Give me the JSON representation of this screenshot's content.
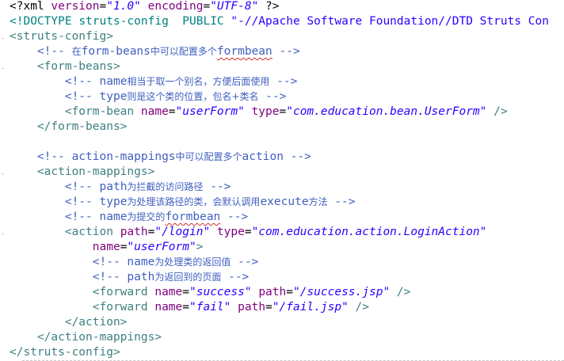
{
  "editor": {
    "lines": [
      [
        "<?xml version=\"1.0\" encoding=\"UTF-8\" ?>"
      ],
      [
        "<!DOCTYPE struts-config  PUBLIC \"-//Apache Software Foundation//DTD Struts Con"
      ],
      [
        "<struts-config>"
      ],
      [
        "    <!-- 在form-beans中可以配置多个formbean -->"
      ],
      [
        "    <form-beans>"
      ],
      [
        "        <!-- name相当于取一个别名，方便后面使用 -->"
      ],
      [
        "        <!-- type则是这个类的位置，包名+类名 -->"
      ],
      [
        "        <form-bean name=\"userForm\" type=\"com.education.bean.UserForm\" />"
      ],
      [
        "    </form-beans>"
      ],
      [
        ""
      ],
      [
        "    <!-- action-mappings中可以配置多个action -->"
      ],
      [
        "    <action-mappings>"
      ],
      [
        "        <!-- path为拦截的访问路径 -->"
      ],
      [
        "        <!-- type为处理该路径的类，会默认调用execute方法 -->"
      ],
      [
        "        <!-- name为提交的formbean -->"
      ],
      [
        "        <action path=\"/login\" type=\"com.education.action.LoginAction\""
      ],
      [
        "            name=\"userForm\">"
      ],
      [
        "            <!-- name为处理类的返回值 -->"
      ],
      [
        "            <!-- path为返回到的页面 -->"
      ],
      [
        "            <forward name=\"success\" path=\"/success.jsp\" />"
      ],
      [
        "            <forward name=\"fail\" path=\"/fail.jsp\" />"
      ],
      [
        "        </action>"
      ],
      [
        "    </action-mappings>"
      ],
      [
        "</struts-config>"
      ]
    ],
    "tokens": {
      "l0": [
        {
          "t": "<?xml ",
          "c": "pi"
        },
        {
          "t": "version",
          "c": "attr"
        },
        {
          "t": "=",
          "c": "pi"
        },
        {
          "t": "\"1.0\"",
          "c": "val"
        },
        {
          "t": " ",
          "c": "pi"
        },
        {
          "t": "encoding",
          "c": "attr"
        },
        {
          "t": "=",
          "c": "pi"
        },
        {
          "t": "\"UTF-8\"",
          "c": "val"
        },
        {
          "t": " ?>",
          "c": "pi"
        }
      ],
      "l1": [
        {
          "t": "<!DOCTYPE ",
          "c": "decl"
        },
        {
          "t": "struts-config",
          "c": "decl"
        },
        {
          "t": "  PUBLIC ",
          "c": "decl"
        },
        {
          "t": "\"-//Apache Software Foundation//DTD Struts Con",
          "c": "doctxt"
        }
      ],
      "l2": [
        {
          "t": "<struts-config>",
          "c": "tag"
        }
      ],
      "l3": [
        {
          "t": "    ",
          "c": ""
        },
        {
          "t": "<!-- ",
          "c": "cm"
        },
        {
          "t": "在",
          "c": "cm cjk"
        },
        {
          "t": "form-beans",
          "c": "cm"
        },
        {
          "t": "中可以配置多个",
          "c": "cm cjk"
        },
        {
          "t": "formbean",
          "c": "cm squiggle"
        },
        {
          "t": " -->",
          "c": "cm"
        }
      ],
      "l4": [
        {
          "t": "    ",
          "c": ""
        },
        {
          "t": "<form-beans>",
          "c": "tag"
        }
      ],
      "l5": [
        {
          "t": "        ",
          "c": ""
        },
        {
          "t": "<!-- ",
          "c": "cm"
        },
        {
          "t": "name",
          "c": "cm"
        },
        {
          "t": "相当于取一个别名，方便后面使用",
          "c": "cm cjk"
        },
        {
          "t": " -->",
          "c": "cm"
        }
      ],
      "l6": [
        {
          "t": "        ",
          "c": ""
        },
        {
          "t": "<!-- ",
          "c": "cm"
        },
        {
          "t": "type",
          "c": "cm"
        },
        {
          "t": "则是这个类的位置，包名+类名",
          "c": "cm cjk"
        },
        {
          "t": " -->",
          "c": "cm"
        }
      ],
      "l7": [
        {
          "t": "        ",
          "c": ""
        },
        {
          "t": "<form-bean ",
          "c": "tag"
        },
        {
          "t": "name",
          "c": "attr"
        },
        {
          "t": "=",
          "c": ""
        },
        {
          "t": "\"userForm\"",
          "c": "val"
        },
        {
          "t": " ",
          "c": ""
        },
        {
          "t": "type",
          "c": "attr"
        },
        {
          "t": "=",
          "c": ""
        },
        {
          "t": "\"com.education.bean.UserForm\"",
          "c": "val"
        },
        {
          "t": " />",
          "c": "tag"
        }
      ],
      "l8": [
        {
          "t": "    ",
          "c": ""
        },
        {
          "t": "</form-beans>",
          "c": "tag"
        }
      ],
      "l9": [
        {
          "t": "",
          "c": ""
        }
      ],
      "l10": [
        {
          "t": "    ",
          "c": ""
        },
        {
          "t": "<!-- ",
          "c": "cm"
        },
        {
          "t": "action-mappings",
          "c": "cm"
        },
        {
          "t": "中可以配置多个",
          "c": "cm cjk"
        },
        {
          "t": "action",
          "c": "cm"
        },
        {
          "t": " -->",
          "c": "cm"
        }
      ],
      "l11": [
        {
          "t": "    ",
          "c": ""
        },
        {
          "t": "<action-mappings>",
          "c": "tag"
        }
      ],
      "l12": [
        {
          "t": "        ",
          "c": ""
        },
        {
          "t": "<!-- ",
          "c": "cm"
        },
        {
          "t": "path",
          "c": "cm"
        },
        {
          "t": "为拦截的访问路径",
          "c": "cm cjk"
        },
        {
          "t": " -->",
          "c": "cm"
        }
      ],
      "l13": [
        {
          "t": "        ",
          "c": ""
        },
        {
          "t": "<!-- ",
          "c": "cm"
        },
        {
          "t": "type",
          "c": "cm"
        },
        {
          "t": "为处理该路径的类，会默认调用",
          "c": "cm cjk"
        },
        {
          "t": "execute",
          "c": "cm"
        },
        {
          "t": "方法",
          "c": "cm cjk"
        },
        {
          "t": " -->",
          "c": "cm"
        }
      ],
      "l14": [
        {
          "t": "        ",
          "c": ""
        },
        {
          "t": "<!-- ",
          "c": "cm"
        },
        {
          "t": "name",
          "c": "cm"
        },
        {
          "t": "为提交的",
          "c": "cm cjk"
        },
        {
          "t": "formbean",
          "c": "cm squiggle"
        },
        {
          "t": " -->",
          "c": "cm"
        }
      ],
      "l15": [
        {
          "t": "        ",
          "c": ""
        },
        {
          "t": "<action ",
          "c": "tag"
        },
        {
          "t": "path",
          "c": "attr"
        },
        {
          "t": "=",
          "c": ""
        },
        {
          "t": "\"/login\"",
          "c": "val"
        },
        {
          "t": " ",
          "c": ""
        },
        {
          "t": "type",
          "c": "attr"
        },
        {
          "t": "=",
          "c": ""
        },
        {
          "t": "\"com.education.action.LoginAction\"",
          "c": "val"
        }
      ],
      "l16": [
        {
          "t": "            ",
          "c": ""
        },
        {
          "t": "name",
          "c": "attr"
        },
        {
          "t": "=",
          "c": ""
        },
        {
          "t": "\"userForm\"",
          "c": "val"
        },
        {
          "t": ">",
          "c": "tag"
        }
      ],
      "l17": [
        {
          "t": "            ",
          "c": ""
        },
        {
          "t": "<!-- ",
          "c": "cm"
        },
        {
          "t": "name",
          "c": "cm"
        },
        {
          "t": "为处理类的返回值",
          "c": "cm cjk"
        },
        {
          "t": " -->",
          "c": "cm"
        }
      ],
      "l18": [
        {
          "t": "            ",
          "c": ""
        },
        {
          "t": "<!-- ",
          "c": "cm"
        },
        {
          "t": "path",
          "c": "cm"
        },
        {
          "t": "为返回到的页面",
          "c": "cm cjk"
        },
        {
          "t": " -->",
          "c": "cm"
        }
      ],
      "l19": [
        {
          "t": "            ",
          "c": ""
        },
        {
          "t": "<forward ",
          "c": "tag"
        },
        {
          "t": "name",
          "c": "attr"
        },
        {
          "t": "=",
          "c": ""
        },
        {
          "t": "\"success\"",
          "c": "val"
        },
        {
          "t": " ",
          "c": ""
        },
        {
          "t": "path",
          "c": "attr"
        },
        {
          "t": "=",
          "c": ""
        },
        {
          "t": "\"/success.jsp\"",
          "c": "val"
        },
        {
          "t": " />",
          "c": "tag"
        }
      ],
      "l20": [
        {
          "t": "            ",
          "c": ""
        },
        {
          "t": "<forward ",
          "c": "tag"
        },
        {
          "t": "name",
          "c": "attr"
        },
        {
          "t": "=",
          "c": ""
        },
        {
          "t": "\"fail\"",
          "c": "val"
        },
        {
          "t": " ",
          "c": ""
        },
        {
          "t": "path",
          "c": "attr"
        },
        {
          "t": "=",
          "c": ""
        },
        {
          "t": "\"/fail.jsp\"",
          "c": "val"
        },
        {
          "t": " />",
          "c": "tag"
        }
      ],
      "l21": [
        {
          "t": "        ",
          "c": ""
        },
        {
          "t": "</action>",
          "c": "tag"
        }
      ],
      "l22": [
        {
          "t": "    ",
          "c": ""
        },
        {
          "t": "</action-mappings>",
          "c": "tag"
        }
      ],
      "l23": [
        {
          "t": "</struts-config>",
          "c": "tag"
        }
      ]
    },
    "fold_markers": {
      "m2": "-",
      "m4": "-",
      "m11": "-",
      "m15": "-"
    }
  },
  "colors": {
    "comment": "#3f5fbf",
    "tag": "#3f7f7f",
    "attribute": "#7f007f",
    "value": "#2a00ff",
    "doctype": "#008080",
    "background": "#ffffff"
  }
}
